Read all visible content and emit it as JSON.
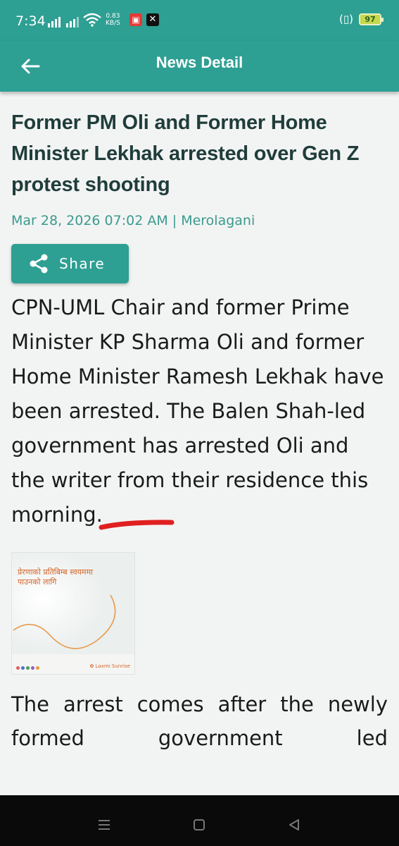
{
  "status_bar": {
    "time": "7:34",
    "net_speed_value": "0.83",
    "net_speed_unit": "KB/S",
    "battery": "97",
    "icons": [
      "signal-icon",
      "signal-icon",
      "signal-icon",
      "wifi-icon",
      "notification-app-icon",
      "x-app-icon",
      "vibrate-icon",
      "battery-icon"
    ]
  },
  "app_bar": {
    "title": "News Detail",
    "back_icon": "arrow-left-icon"
  },
  "article": {
    "headline": "Former PM Oli and Former Home Minister Lekhak arrested over Gen Z protest shooting",
    "meta": "Mar 28, 2026 07:02 AM | Merolagani",
    "share_label": "Share",
    "paragraph1": "CPN-UML Chair and former Prime Minister KP Sharma Oli and former Home Minister Ramesh Lekhak have been arrested. The Balen Shah-led government has arrested Oli and the writer from their residence this morning.",
    "paragraph2_visible": "The arrest comes after the newly formed government led"
  },
  "ad": {
    "line1": "प्रेरणाको प्रतिबिम्ब स्वयममा",
    "line2": "पाउनको लागि",
    "brand": "Laxmi Sunrise"
  },
  "colors": {
    "primary": "#2e9f93",
    "headline": "#1f3d3a",
    "meta": "#3b9a8f",
    "body": "#1a1a1a",
    "annotation": "#e02020"
  },
  "nav_bar": {
    "icons": [
      "menu-icon",
      "home-icon",
      "back-triangle-icon"
    ]
  }
}
